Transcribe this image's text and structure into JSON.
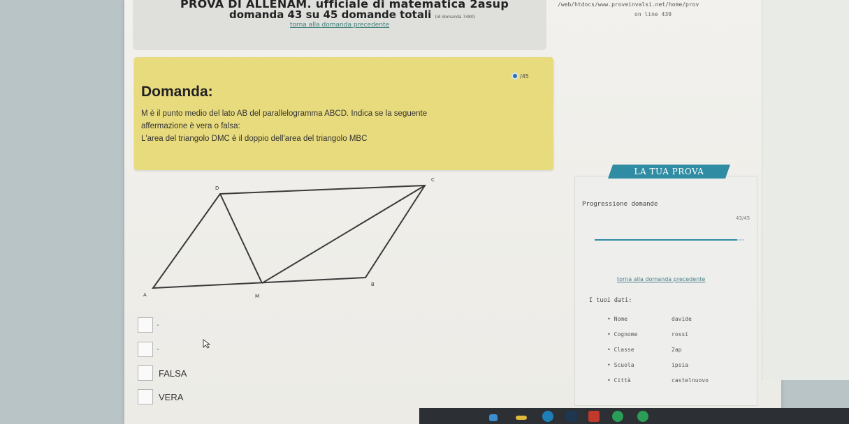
{
  "header": {
    "exam_title": "PROVA DI ALLENAM. ufficiale di matematica 2asup",
    "question_counter": "domanda 43 su 45 domande totali",
    "question_counter_note": "(id domanda 7480)",
    "back_link": "torna alla domanda precedente"
  },
  "browser": {
    "url": "/web/htdocs/www.proveinvalsi.net/home/prov",
    "line_info": "on line 439"
  },
  "question": {
    "timer_text": "/45",
    "heading": "Domanda:",
    "line1": "M è il punto medio del lato AB del parallelogramma ABCD. Indica se la seguente",
    "line2": "affermazione è vera o falsa:",
    "line3": "L'area del triangolo DMC è il doppio dell'area del triangolo MBC"
  },
  "figure": {
    "labels": {
      "A": "A",
      "B": "B",
      "C": "C",
      "D": "D",
      "M": "M"
    }
  },
  "answers": {
    "empty1_dash": "-",
    "empty2_dash": "-",
    "false_label": "FALSA",
    "true_label": "VERA"
  },
  "sidebar": {
    "banner": "LA TUA PROVA",
    "progress_label": "Progressione domande",
    "progress_count": "43/45",
    "progress_fraction": 0.955,
    "back_link": "torna alla domanda precedente",
    "data_title": "I tuoi dati:",
    "fields": [
      {
        "key": "Nome",
        "value": "davide"
      },
      {
        "key": "Cognome",
        "value": "rossi"
      },
      {
        "key": "Classe",
        "value": "2ap"
      },
      {
        "key": "Scuola",
        "value": "ipsia"
      },
      {
        "key": "Città",
        "value": "castelnuovo"
      }
    ]
  },
  "colors": {
    "question_bg": "#e8db7e",
    "accent": "#2f8ca3",
    "link": "#3f7f79"
  }
}
